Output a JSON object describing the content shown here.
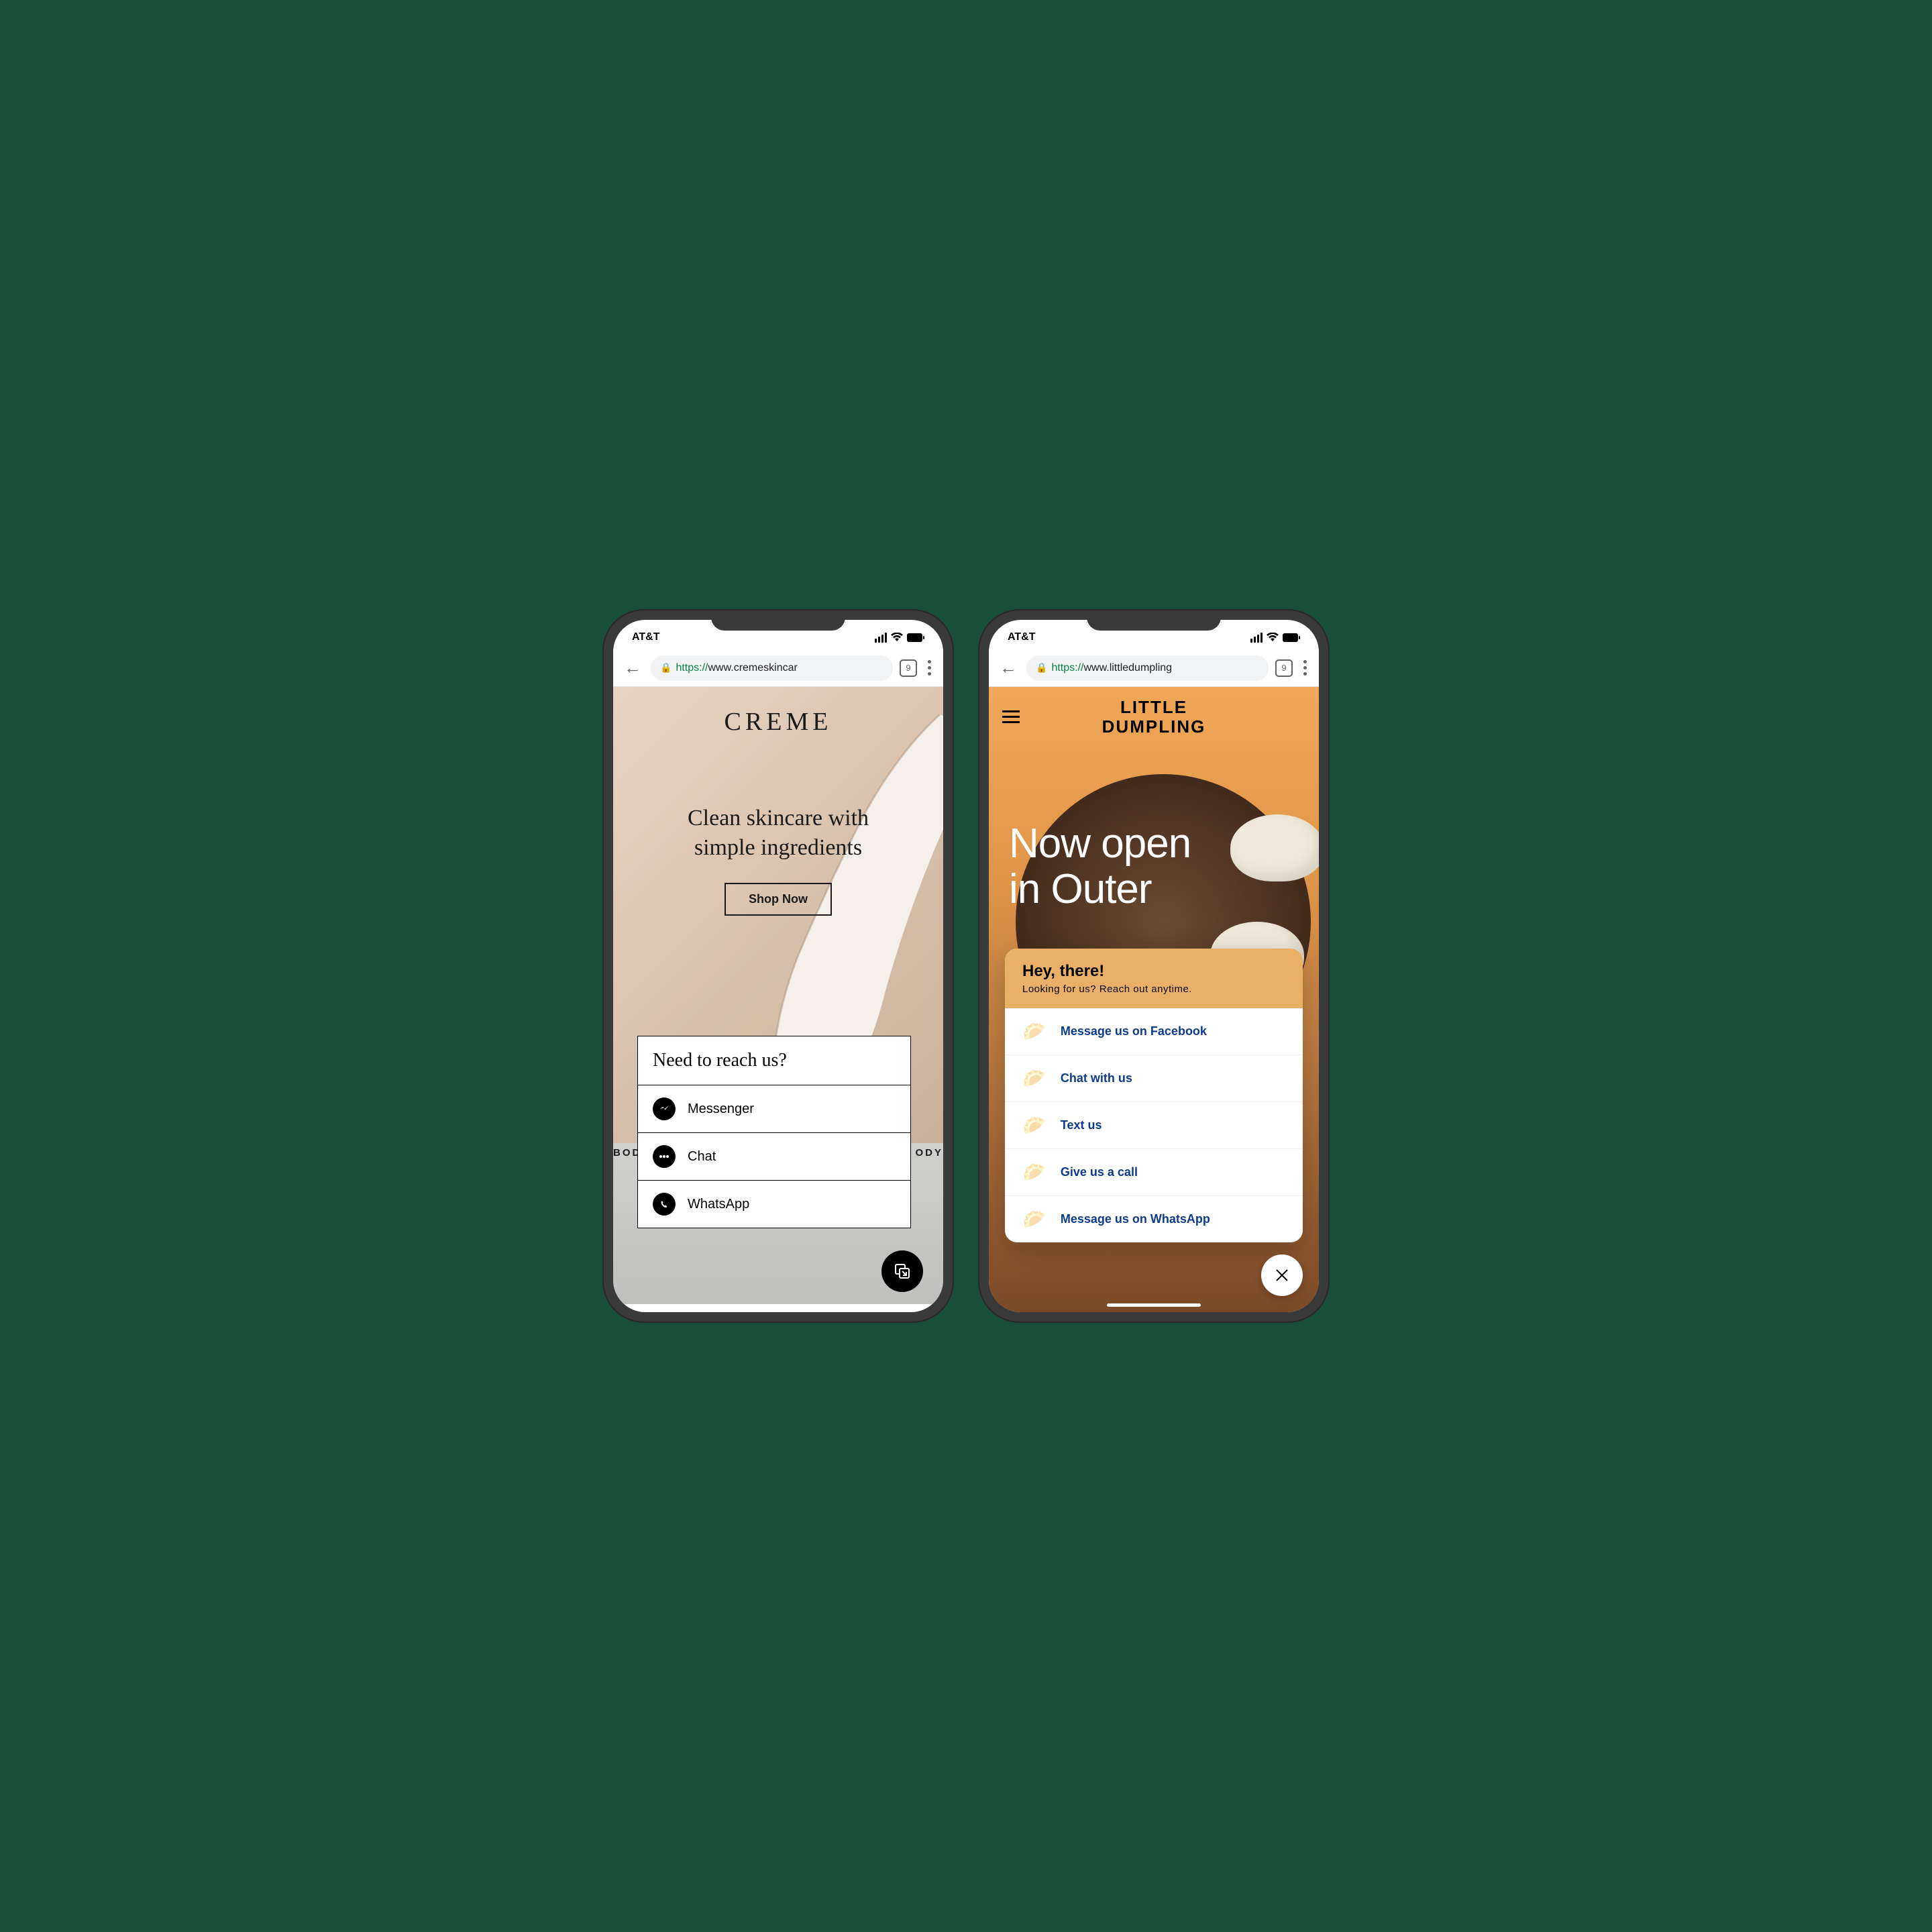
{
  "phone1": {
    "carrier": "AT&T",
    "tab_count": "9",
    "url_protocol": "https://",
    "url_domain": "www.cremeskincar",
    "brand": "CREME",
    "tagline_line1": "Clean skincare with",
    "tagline_line2": "simple ingredients",
    "shop_button": "Shop Now",
    "nav_left": "BOD",
    "nav_right": "ODY",
    "contact": {
      "header": "Need to reach us?",
      "items": [
        {
          "label": "Messenger",
          "icon": "messenger"
        },
        {
          "label": "Chat",
          "icon": "chat"
        },
        {
          "label": "WhatsApp",
          "icon": "whatsapp"
        }
      ]
    }
  },
  "phone2": {
    "carrier": "AT&T",
    "tab_count": "9",
    "url_protocol": "https://",
    "url_domain": "www.littledumpling",
    "brand_line1": "LITTLE",
    "brand_line2": "DUMPLING",
    "headline_line1": "Now open",
    "headline_line2": "in Outer",
    "chat": {
      "title": "Hey, there!",
      "subtitle": "Looking for us? Reach out anytime.",
      "items": [
        "Message us on Facebook",
        "Chat with us",
        "Text us",
        "Give us a call",
        "Message us on WhatsApp"
      ]
    }
  }
}
